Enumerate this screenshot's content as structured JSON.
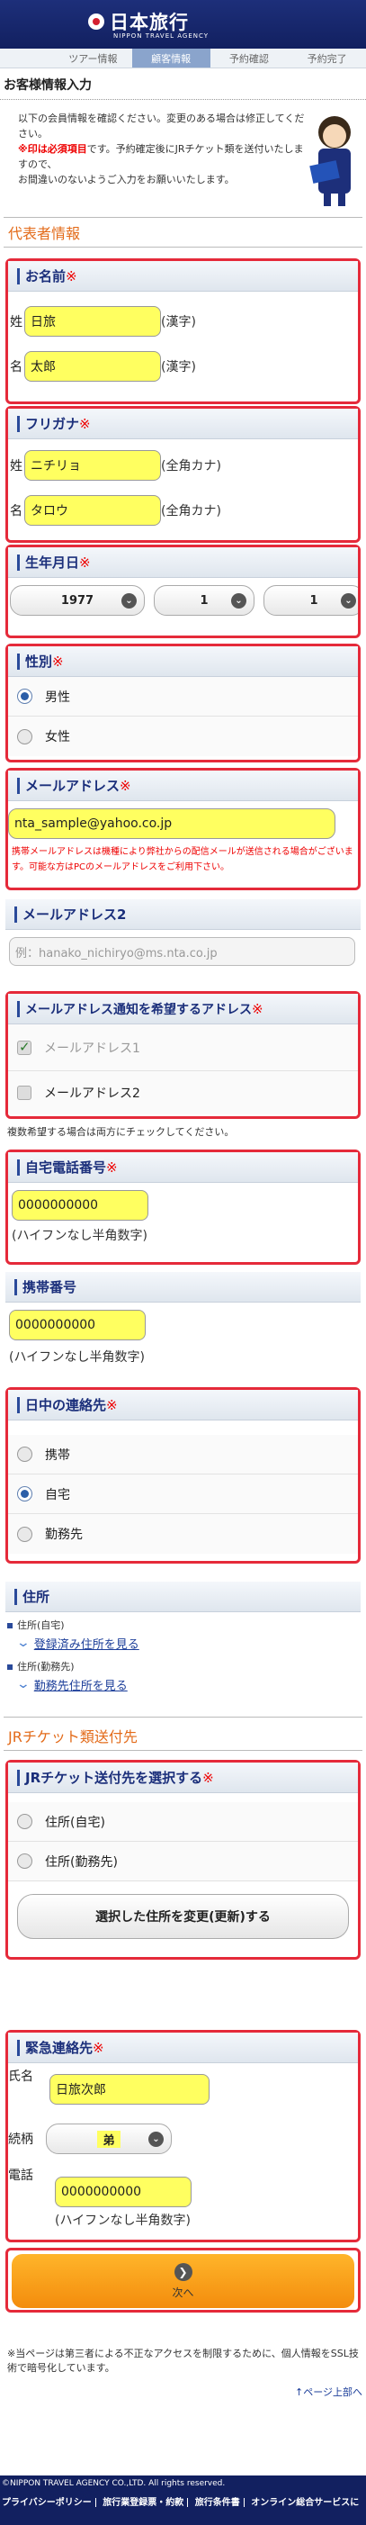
{
  "header": {
    "logo_text": "日本旅行",
    "logo_sub": "NIPPON TRAVEL AGENCY"
  },
  "steps": [
    "ツアー情報",
    "顧客情報",
    "予約確認",
    "予約完了"
  ],
  "page_title": "お客様情報入力",
  "intro": {
    "line1": "以下の会員情報を確認ください。変更のある場合は修正してください。",
    "required_prefix": "※印は必須項目",
    "line2": "です。予約確定後にJRチケット類を送付いたしますので、",
    "line3": "お間違いのないようご入力をお願いいたします。"
  },
  "sections": {
    "representative": "代表者情報",
    "jr": "JRチケット類送付先"
  },
  "required_mark": "※",
  "name": {
    "title": "お名前",
    "sei_label": "姓",
    "mei_label": "名",
    "sei": "日旅",
    "mei": "太郎",
    "note": "(漢字)"
  },
  "furigana": {
    "title": "フリガナ",
    "sei_label": "姓",
    "mei_label": "名",
    "sei": "ニチリョ",
    "mei": "タロウ",
    "note": "(全角カナ)"
  },
  "birth": {
    "title": "生年月日",
    "year": "1977",
    "month": "1",
    "day": "1"
  },
  "gender": {
    "title": "性別",
    "options": [
      "男性",
      "女性"
    ],
    "selected": "男性"
  },
  "email": {
    "title": "メールアドレス",
    "value": "nta_sample@yahoo.co.jp",
    "warning": "携帯メールアドレスは機種により弊社からの配信メールが送信される場合がございます。可能な方はPCのメールアドレスをご利用下さい。"
  },
  "email2": {
    "title": "メールアドレス2",
    "placeholder": "例：hanako_nichiryo@ms.nta.co.jp"
  },
  "notify": {
    "title": "メールアドレス通知を希望するアドレス",
    "opt1": "メールアドレス1",
    "opt2": "メールアドレス2",
    "note": "複数希望する場合は両方にチェックしてください。"
  },
  "home_phone": {
    "title": "自宅電話番号",
    "value": "0000000000",
    "note": "(ハイフンなし半角数字)"
  },
  "mobile": {
    "title": "携帯番号",
    "value": "0000000000",
    "note": "(ハイフンなし半角数字)"
  },
  "daytime": {
    "title": "日中の連絡先",
    "options": [
      "携帯",
      "自宅",
      "勤務先"
    ],
    "selected": "自宅"
  },
  "address": {
    "title": "住所",
    "home_label": "住所(自宅)",
    "home_link": "登録済み住所を見る",
    "work_label": "住所(勤務先)",
    "work_link": "勤務先住所を見る"
  },
  "jr_select": {
    "title": "JRチケット送付先を選択する",
    "options": [
      "住所(自宅)",
      "住所(勤務先)"
    ],
    "button": "選択した住所を変更(更新)する"
  },
  "emergency": {
    "title": "緊急連絡先",
    "name_label": "氏名",
    "name": "日旅次郎",
    "rel_label": "続柄",
    "relation": "弟",
    "phone_label": "電話",
    "phone": "0000000000",
    "phone_note": "(ハイフンなし半角数字)"
  },
  "next": {
    "label": "次へ"
  },
  "ssl_note": "※当ページは第三者による不正なアクセスを制限するために、個人情報をSSL技術で暗号化しています。",
  "page_top": "↑ページ上部へ",
  "footer": {
    "copyright": "©NIPPON TRAVEL AGENCY CO.,LTD. All rights reserved.",
    "links": [
      "プライバシーポリシー",
      "旅行業登録票・約款",
      "旅行条件書",
      "オンライン総合サービスに"
    ]
  }
}
